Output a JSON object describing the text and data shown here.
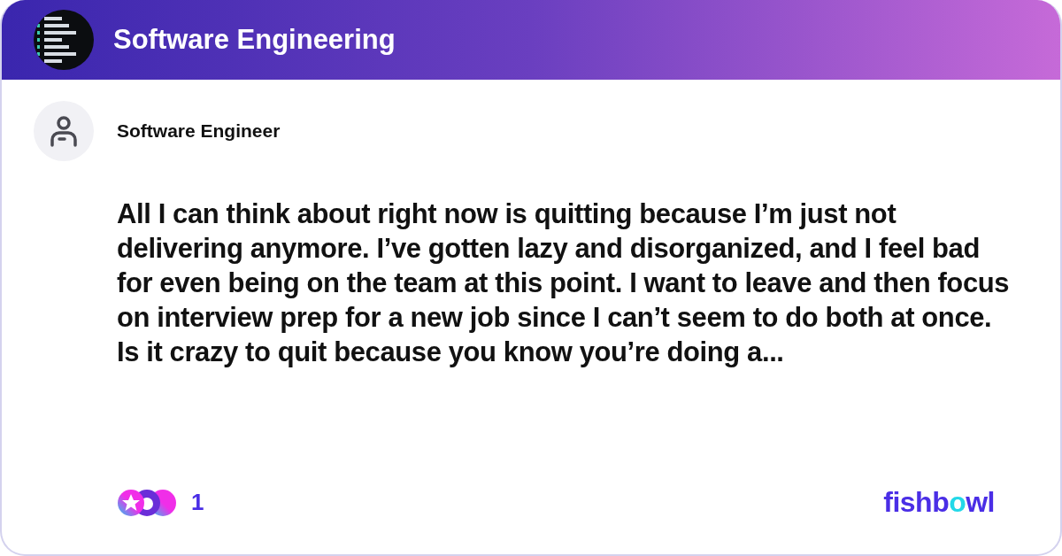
{
  "header": {
    "title": "Software Engineering"
  },
  "post": {
    "author": "Software Engineer",
    "body": "All I can think about right now is quitting because I’m just not delivering anymore. I’ve gotten lazy and disorganized, and I feel bad for even being on the team at this point. I want to leave and then focus on interview prep for a new job since I can’t seem to do both at once. Is it crazy to quit because you know you’re doing a..."
  },
  "footer": {
    "reaction_count": "1",
    "logo": "fishbowl"
  }
}
